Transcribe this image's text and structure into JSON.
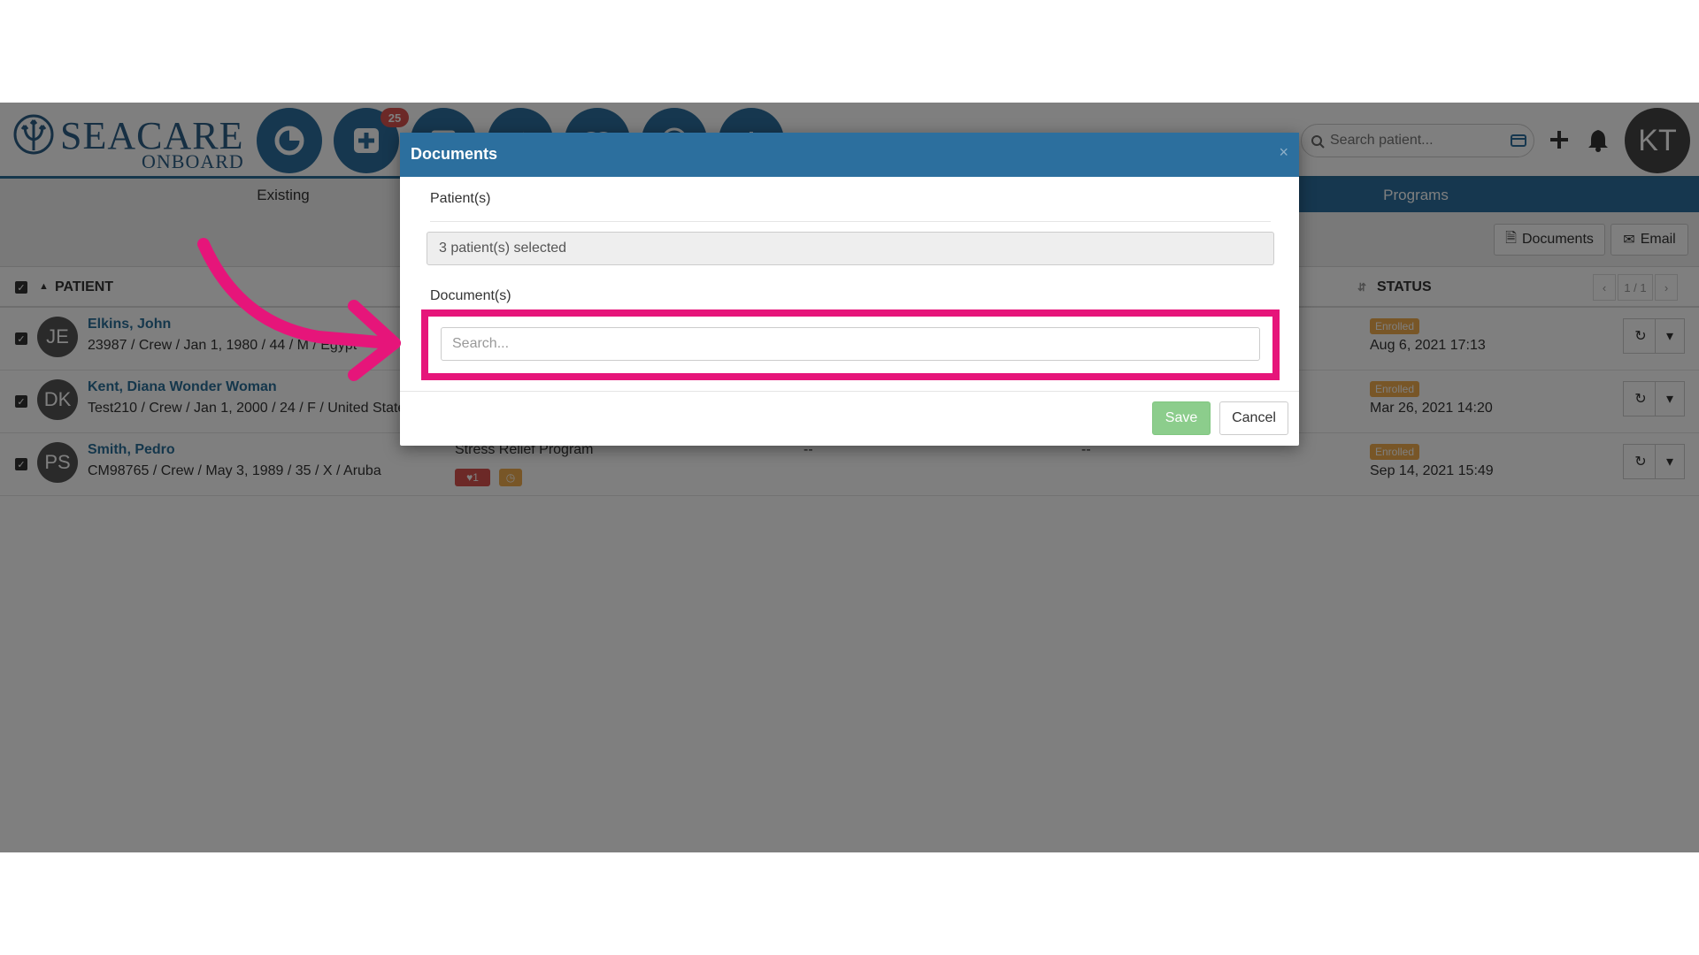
{
  "app": {
    "logo_main": "SEACARE",
    "logo_sub": "ONBOARD",
    "notification_count": "25",
    "search_placeholder": "Search patient...",
    "user_initials": "KT"
  },
  "tabs": {
    "existing": "Existing",
    "programs": "Programs"
  },
  "toolbar": {
    "documents_label": "Documents",
    "email_label": "Email"
  },
  "table": {
    "col_patient": "PATIENT",
    "col_status": "STATUS",
    "pager": "1 / 1",
    "rows": [
      {
        "initials": "JE",
        "name": "Elkins, John",
        "info": "23987 / Crew / Jan 1, 1980 / 44 / M / Egypt",
        "program": "",
        "dash1": "",
        "dash2": "",
        "status": "Enrolled",
        "date": "Aug 6, 2021 17:13"
      },
      {
        "initials": "DK",
        "name": "Kent, Diana Wonder Woman",
        "info": "Test210 / Crew / Jan 1, 2000 / 24 / F / United States",
        "program": "",
        "dash1": "",
        "dash2": "",
        "status": "Enrolled",
        "date": "Mar 26, 2021 14:20"
      },
      {
        "initials": "PS",
        "name": "Smith, Pedro",
        "info": "CM98765 / Crew / May 3, 1989 / 35 / X / Aruba",
        "program": "Stress Relief Program",
        "dash1": "--",
        "dash2": "--",
        "status": "Enrolled",
        "date": "Sep 14, 2021 15:49",
        "badge_heart": "1"
      }
    ]
  },
  "modal": {
    "title": "Documents",
    "close": "×",
    "patients_label": "Patient(s)",
    "patients_value": "3 patient(s) selected",
    "documents_label": "Document(s)",
    "documents_placeholder": "Search...",
    "save_label": "Save",
    "cancel_label": "Cancel"
  },
  "colors": {
    "brand": "#2c6f9e",
    "highlight": "#e6157a",
    "status_enrolled": "#f0ad4e",
    "save": "#5cb85c"
  }
}
